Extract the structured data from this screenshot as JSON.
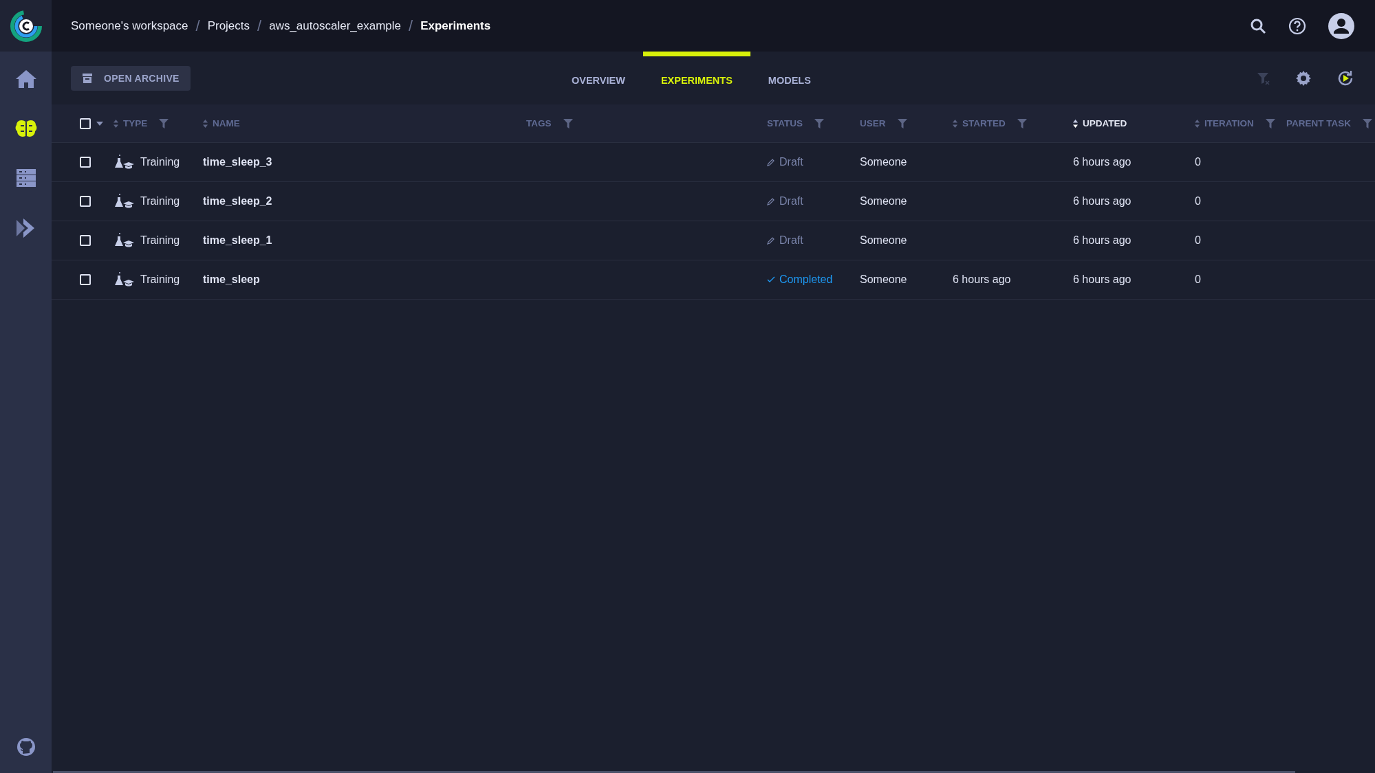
{
  "breadcrumbs": [
    {
      "label": "Someone's workspace",
      "current": false
    },
    {
      "separator": "/",
      "label": "Projects",
      "current": false
    },
    {
      "separator": "/",
      "label": "aws_autoscaler_example",
      "current": false
    },
    {
      "separator": "/",
      "label": "Experiments",
      "current": true
    }
  ],
  "sidebar": {
    "items": [
      {
        "kind": "home",
        "selected": false
      },
      {
        "kind": "brain",
        "selected": true
      },
      {
        "kind": "datasets",
        "selected": false
      },
      {
        "kind": "pipelines",
        "selected": false
      }
    ]
  },
  "archive_button": "OPEN ARCHIVE",
  "tabs": [
    {
      "label": "OVERVIEW",
      "selected": false
    },
    {
      "label": "EXPERIMENTS",
      "selected": true
    },
    {
      "label": "MODELS",
      "selected": false
    }
  ],
  "table": {
    "columns": [
      {
        "label": "TYPE",
        "sortable": true,
        "filter": true,
        "sorted": false
      },
      {
        "label": "NAME",
        "sortable": true,
        "filter": false,
        "sorted": false
      },
      {
        "label": "TAGS",
        "sortable": false,
        "filter": true,
        "sorted": false
      },
      {
        "label": "STATUS",
        "sortable": false,
        "filter": true,
        "sorted": false
      },
      {
        "label": "USER",
        "sortable": false,
        "filter": true,
        "sorted": false
      },
      {
        "label": "STARTED",
        "sortable": true,
        "filter": true,
        "sorted": false
      },
      {
        "label": "UPDATED",
        "sortable": true,
        "filter": false,
        "sorted": true
      },
      {
        "label": "ITERATION",
        "sortable": true,
        "filter": true,
        "sorted": false
      },
      {
        "label": "PARENT TASK",
        "sortable": false,
        "filter": true,
        "sorted": false
      }
    ],
    "select_all_checked": false,
    "rows": [
      {
        "checked": false,
        "type": "Training",
        "name": "time_sleep_3",
        "status": {
          "kind": "draft",
          "label": "Draft"
        },
        "user": "Someone",
        "updated": "6 hours ago",
        "iteration": "0"
      },
      {
        "checked": false,
        "type": "Training",
        "name": "time_sleep_2",
        "status": {
          "kind": "draft",
          "label": "Draft"
        },
        "user": "Someone",
        "updated": "6 hours ago",
        "iteration": "0"
      },
      {
        "checked": false,
        "type": "Training",
        "name": "time_sleep_1",
        "status": {
          "kind": "draft",
          "label": "Draft"
        },
        "user": "Someone",
        "updated": "6 hours ago",
        "iteration": "0"
      },
      {
        "checked": false,
        "type": "Training",
        "name": "time_sleep",
        "status": {
          "kind": "completed",
          "label": "Completed"
        },
        "user": "Someone",
        "started": "6 hours ago",
        "updated": "6 hours ago",
        "iteration": "0"
      }
    ]
  }
}
